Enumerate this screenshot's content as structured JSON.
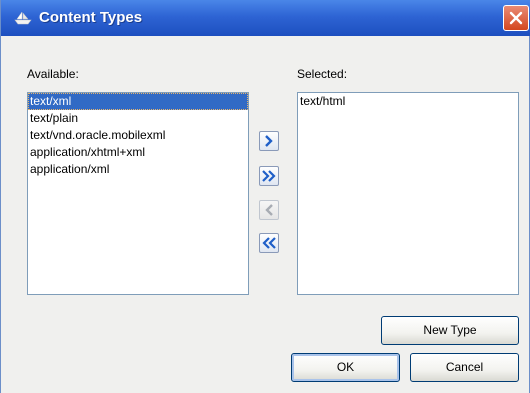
{
  "window": {
    "title": "Content Types",
    "close_icon": "close-icon"
  },
  "available": {
    "label": "Available:",
    "items": [
      "text/xml",
      "text/plain",
      "text/vnd.oracle.mobilexml",
      "application/xhtml+xml",
      "application/xml"
    ],
    "selected_index": 0
  },
  "selected": {
    "label": "Selected:",
    "items": [
      "text/html"
    ]
  },
  "move_buttons": [
    {
      "name": "move-right",
      "icon": "chevron-right-icon",
      "enabled": true
    },
    {
      "name": "move-all-right",
      "icon": "double-chevron-right-icon",
      "enabled": true
    },
    {
      "name": "move-left",
      "icon": "chevron-left-icon",
      "enabled": false
    },
    {
      "name": "move-all-left",
      "icon": "double-chevron-left-icon",
      "enabled": true
    }
  ],
  "buttons": {
    "new_type": "New Type",
    "ok": "OK",
    "cancel": "Cancel"
  },
  "colors": {
    "titlebar": "#2e64d4",
    "selection": "#316ac5",
    "close": "#d4471f"
  }
}
